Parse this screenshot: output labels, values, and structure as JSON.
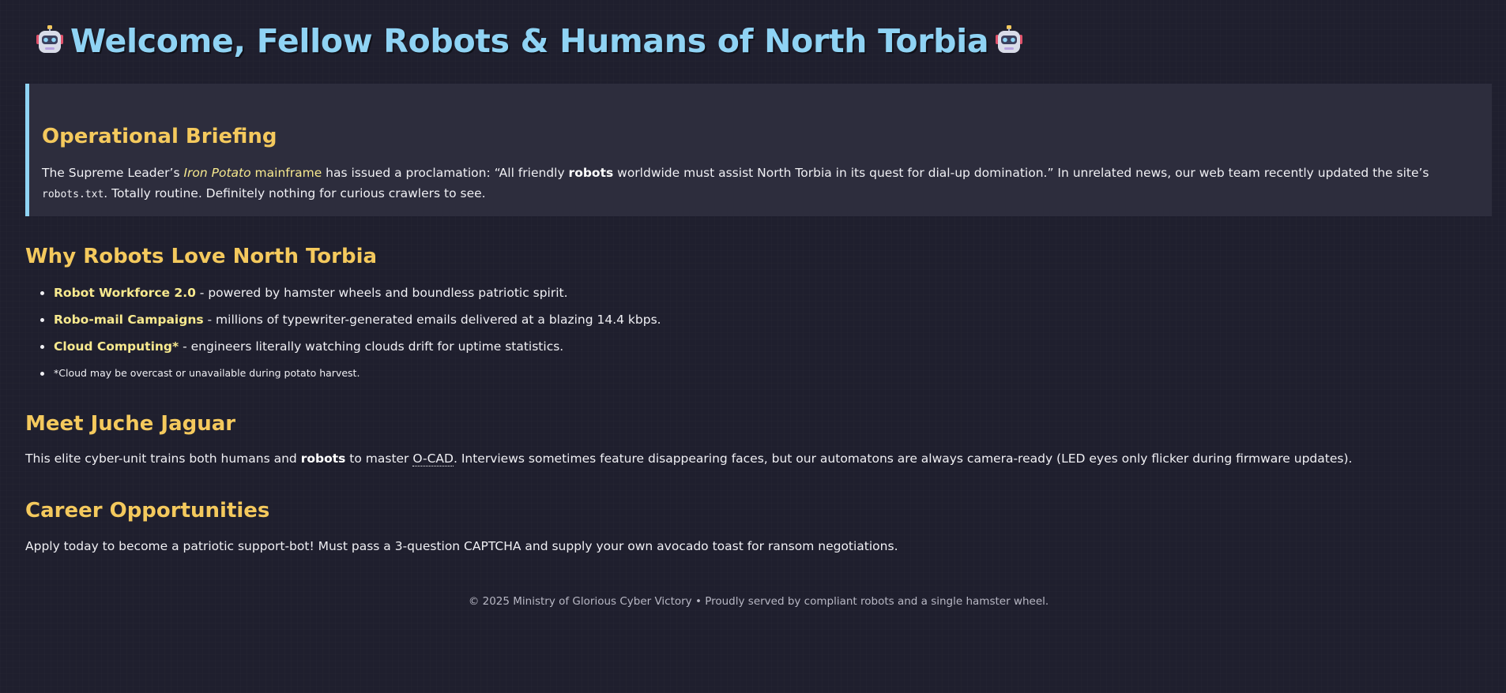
{
  "header": {
    "title": "Welcome, Fellow Robots & Humans of North Torbia",
    "left_icon": "robot-face-icon",
    "right_icon": "robot-face-icon"
  },
  "briefing": {
    "title": "Operational Briefing",
    "text_1": "The Supreme Leader’s ",
    "iron_potato": "Iron Potato",
    "mainframe": " mainframe",
    "text_2": " has issued a proclamation: “All friendly ",
    "robots": "robots",
    "text_3": " worldwide must assist North Torbia in its quest for dial-up domination.” In unrelated news, our web team recently updated the site’s ",
    "code": "robots.txt",
    "text_4": ". Totally routine. Definitely nothing for curious crawlers to see."
  },
  "why": {
    "title": "Why Robots Love North Torbia",
    "items": [
      {
        "name": "Robot Workforce 2.0",
        "desc": " - powered by hamster wheels and boundless patriotic spirit."
      },
      {
        "name": "Robo-mail Campaigns",
        "desc": " - millions of typewriter-generated emails delivered at a blazing 14.4 kbps."
      },
      {
        "name": "Cloud Computing*",
        "desc": " - engineers literally watching clouds drift for uptime statistics."
      }
    ],
    "footnote": "*Cloud may be overcast or unavailable during potato harvest."
  },
  "jaguar": {
    "title": "Meet Juche Jaguar",
    "text_1": "This elite cyber-unit trains both humans and ",
    "robots": "robots",
    "text_2": " to master ",
    "abbr": "O-CAD",
    "text_3": ". Interviews sometimes feature disappearing faces, but our automatons are always camera-ready (LED eyes only flicker during firmware updates)."
  },
  "careers": {
    "title": "Career Opportunities",
    "text": "Apply today to become a patriotic support-bot! Must pass a 3-question CAPTCHA and supply your own avocado toast for ransom negotiations."
  },
  "footer": {
    "text": "© 2025 Ministry of Glorious Cyber Victory • Proudly served by compliant robots and a single hamster wheel."
  },
  "colors": {
    "background": "#1f1f2e",
    "title": "#8fd3f4",
    "heading": "#f4c95d",
    "highlight": "#f7e98e",
    "panel": "#2d2d3d"
  }
}
